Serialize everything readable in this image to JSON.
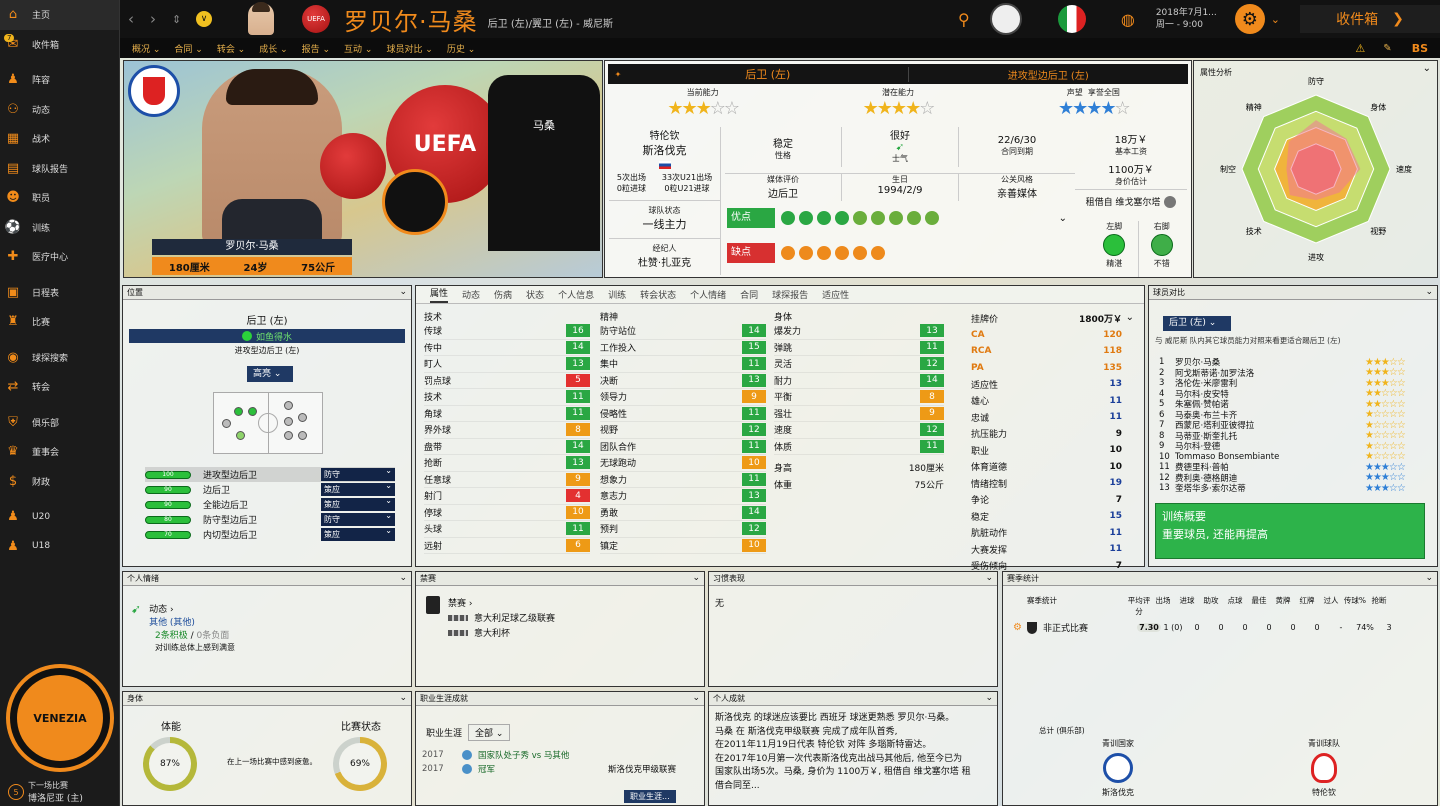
{
  "sidebar": {
    "items": [
      {
        "label": "主页",
        "icon": "home-icon",
        "glyph": "⌂",
        "selected": true
      },
      {
        "label": "收件箱",
        "icon": "inbox-icon",
        "glyph": "✉",
        "badge": "7"
      },
      {
        "label": "阵容",
        "icon": "squad-icon",
        "glyph": "♟"
      },
      {
        "label": "动态",
        "icon": "dynamics-icon",
        "glyph": "⚇"
      },
      {
        "label": "战术",
        "icon": "tactics-icon",
        "glyph": "▦"
      },
      {
        "label": "球队报告",
        "icon": "team-report-icon",
        "glyph": "▤"
      },
      {
        "label": "职员",
        "icon": "staff-icon",
        "glyph": "☻"
      },
      {
        "label": "训练",
        "icon": "training-icon",
        "glyph": "⚽"
      },
      {
        "label": "医疗中心",
        "icon": "medical-icon",
        "glyph": "✚"
      },
      {
        "label": "日程表",
        "icon": "calendar-icon",
        "glyph": "▣"
      },
      {
        "label": "比赛",
        "icon": "trophy-icon",
        "glyph": "♜"
      },
      {
        "label": "球探搜索",
        "icon": "scouting-icon",
        "glyph": "◉"
      },
      {
        "label": "转会",
        "icon": "transfer-icon",
        "glyph": "⇄"
      },
      {
        "label": "俱乐部",
        "icon": "club-icon",
        "glyph": "⛨"
      },
      {
        "label": "董事会",
        "icon": "board-icon",
        "glyph": "♛"
      },
      {
        "label": "财政",
        "icon": "finance-icon",
        "glyph": "$"
      },
      {
        "label": "U20",
        "icon": "u20-icon",
        "glyph": "♟"
      },
      {
        "label": "U18",
        "icon": "u18-icon",
        "glyph": "♟"
      }
    ],
    "next_match_label": "下一场比赛",
    "next_match_team": "博洛尼亚 (主)",
    "next_match_num": "5"
  },
  "topbar": {
    "player_name": "罗贝尔·马桑",
    "player_positions": "后卫 (左)/翼卫 (左) - 威尼斯",
    "date_line1": "2018年7月1...",
    "date_line2": "周一 - 9:00",
    "inbox_label": "收件箱",
    "uefa_label": "UEFA"
  },
  "subnav": [
    "概况",
    "合同",
    "转会",
    "成长",
    "报告",
    "互动",
    "球员对比",
    "历史"
  ],
  "banner": {
    "name": "罗贝尔·马桑",
    "height": "180厘米",
    "age": "24岁",
    "weight": "75公斤",
    "shirt_name": "马桑",
    "uefa_text": "UEFA",
    "club_badge_text": "VENEZIA"
  },
  "info": {
    "position_main": "后卫 (左)",
    "position_role": "进攻型边后卫 (左)",
    "current_ability_label": "当前能力",
    "current_ability_stars": 3.5,
    "potential_label": "潜在能力",
    "potential_stars": 4.5,
    "reputation_label": "声望",
    "reputation_value": "享誉全国",
    "reputation_stars": 4.5,
    "birthplace": "特伦钦",
    "nationality": "斯洛伐克",
    "apps_line1a": "5次出场",
    "apps_line1b": "0粒进球",
    "apps_line2a": "33次U21出场",
    "apps_line2b": "0粒U21进球",
    "personality_value": "稳定",
    "personality_label": "性格",
    "morale_value": "很好",
    "morale_label": "士气",
    "contract_value": "22/6/30",
    "contract_label": "合同到期",
    "wage_value": "18万￥",
    "wage_label": "基本工资",
    "value_value": "1100万￥",
    "value_label": "身价估计",
    "squad_status_label": "球队状态",
    "squad_status_value": "一线主力",
    "media_label": "媒体评价",
    "media_value": "边后卫",
    "dob_label": "生日",
    "dob_value": "1994/2/9",
    "pr_label": "公关风格",
    "pr_value": "亲善媒体",
    "loan_text": "租借自 维戈塞尔塔",
    "agent_label": "经纪人",
    "agent_value": "杜赞·扎亚克",
    "strengths_label": "优点",
    "weaknesses_label": "缺点",
    "left_foot_label": "左脚",
    "left_foot_value": "精湛",
    "right_foot_label": "右脚",
    "right_foot_value": "不错"
  },
  "attr_analysis": {
    "title": "属性分析",
    "labels": [
      "防守",
      "身体",
      "速度",
      "视野",
      "进攻",
      "技术",
      "制空",
      "精神"
    ],
    "values": [
      0.66,
      0.58,
      0.6,
      0.45,
      0.42,
      0.5,
      0.4,
      0.52
    ],
    "fill_colors": [
      "#9fcf5e",
      "#c6dd70",
      "#f0b43c",
      "#ee6b4f"
    ]
  },
  "position_panel": {
    "title": "位置",
    "main": "后卫 (左)",
    "role_highlight": "如鱼得水",
    "sub": "进攻型边后卫 (左)",
    "dropdown": "高亮",
    "roles": [
      {
        "rating": "100",
        "name": "进攻型边后卫",
        "duty": "防守"
      },
      {
        "rating": "90",
        "name": "边后卫",
        "duty": "策应"
      },
      {
        "rating": "90",
        "name": "全能边后卫",
        "duty": "策应"
      },
      {
        "rating": "80",
        "name": "防守型边后卫",
        "duty": "防守"
      },
      {
        "rating": "70",
        "name": "内切型边后卫",
        "duty": "策应"
      }
    ]
  },
  "attr_tabs": [
    "属性",
    "动态",
    "伤病",
    "状态",
    "个人信息",
    "训练",
    "转会状态",
    "个人情绪",
    "合同",
    "球探报告",
    "适应性"
  ],
  "attributes": {
    "technical_title": "技术",
    "mental_title": "精神",
    "physical_title": "身体",
    "technical": [
      {
        "n": "传球",
        "v": 16
      },
      {
        "n": "传中",
        "v": 14
      },
      {
        "n": "盯人",
        "v": 13
      },
      {
        "n": "罚点球",
        "v": 5
      },
      {
        "n": "技术",
        "v": 11
      },
      {
        "n": "角球",
        "v": 11
      },
      {
        "n": "界外球",
        "v": 8
      },
      {
        "n": "盘带",
        "v": 14
      },
      {
        "n": "抢断",
        "v": 13
      },
      {
        "n": "任意球",
        "v": 9
      },
      {
        "n": "射门",
        "v": 4
      },
      {
        "n": "停球",
        "v": 10
      },
      {
        "n": "头球",
        "v": 11
      },
      {
        "n": "远射",
        "v": 6
      }
    ],
    "mental": [
      {
        "n": "防守站位",
        "v": 14
      },
      {
        "n": "工作投入",
        "v": 15
      },
      {
        "n": "集中",
        "v": 11
      },
      {
        "n": "决断",
        "v": 13
      },
      {
        "n": "领导力",
        "v": 9
      },
      {
        "n": "侵略性",
        "v": 11
      },
      {
        "n": "视野",
        "v": 12
      },
      {
        "n": "团队合作",
        "v": 11
      },
      {
        "n": "无球跑动",
        "v": 10
      },
      {
        "n": "想象力",
        "v": 11
      },
      {
        "n": "意志力",
        "v": 13
      },
      {
        "n": "勇敢",
        "v": 14
      },
      {
        "n": "预判",
        "v": 12
      },
      {
        "n": "镇定",
        "v": 10
      }
    ],
    "physical": [
      {
        "n": "爆发力",
        "v": 13
      },
      {
        "n": "弹跳",
        "v": 11
      },
      {
        "n": "灵活",
        "v": 12
      },
      {
        "n": "耐力",
        "v": 14
      },
      {
        "n": "平衡",
        "v": 8
      },
      {
        "n": "强壮",
        "v": 9
      },
      {
        "n": "速度",
        "v": 12
      },
      {
        "n": "体质",
        "v": 11
      }
    ],
    "height_label": "身高",
    "height_value": "180厘米",
    "weight_label": "体重",
    "weight_value": "75公斤"
  },
  "hidden_attrs": [
    {
      "n": "挂牌价",
      "v": "1800万￥",
      "style": "plain"
    },
    {
      "n": "CA",
      "v": "120",
      "style": "orange"
    },
    {
      "n": "RCA",
      "v": "118",
      "style": "orange"
    },
    {
      "n": "PA",
      "v": "135",
      "style": "orange"
    },
    {
      "n": "适应性",
      "v": "13",
      "style": "blue"
    },
    {
      "n": "雄心",
      "v": "11",
      "style": "blue"
    },
    {
      "n": "忠诚",
      "v": "11",
      "style": "blue"
    },
    {
      "n": "抗压能力",
      "v": "9",
      "style": "plain"
    },
    {
      "n": "职业",
      "v": "10",
      "style": "plain"
    },
    {
      "n": "体育道德",
      "v": "10",
      "style": "plain"
    },
    {
      "n": "情绪控制",
      "v": "19",
      "style": "blue"
    },
    {
      "n": "争论",
      "v": "7",
      "style": "plain"
    },
    {
      "n": "稳定",
      "v": "15",
      "style": "blue"
    },
    {
      "n": "肮脏动作",
      "v": "11",
      "style": "blue"
    },
    {
      "n": "大赛发挥",
      "v": "11",
      "style": "blue"
    },
    {
      "n": "受伤倾向",
      "v": "7",
      "style": "plain"
    }
  ],
  "compare": {
    "title": "球员对比",
    "dropdown": "后卫 (左)",
    "desc": "与 威尼斯 队内其它球员能力对照来看更适合踢后卫 (左)",
    "rows": [
      {
        "n": "1",
        "name": "罗贝尔·马桑",
        "stars": 3.5,
        "color": "gold"
      },
      {
        "n": "2",
        "name": "阿戈斯蒂诺·加罗法洛",
        "stars": 3.5,
        "color": "gold"
      },
      {
        "n": "3",
        "name": "洛伦佐·米廖雷利",
        "stars": 3,
        "color": "gold"
      },
      {
        "n": "4",
        "name": "马尔科·皮安特",
        "stars": 2,
        "color": "gold"
      },
      {
        "n": "5",
        "name": "朱塞佩·赞帕诺",
        "stars": 2,
        "color": "gold"
      },
      {
        "n": "6",
        "name": "马泰奥·布兰卡齐",
        "stars": 1.5,
        "color": "gold"
      },
      {
        "n": "7",
        "name": "西蒙尼·塔利亚彼得拉",
        "stars": 1.5,
        "color": "gold"
      },
      {
        "n": "8",
        "name": "马蒂亚·斯奎扎托",
        "stars": 1.5,
        "color": "gold"
      },
      {
        "n": "9",
        "name": "马尔科·登德",
        "stars": 1.5,
        "color": "gold"
      },
      {
        "n": "10",
        "name": "Tommaso Bonsembiante",
        "stars": 1,
        "color": "gold"
      },
      {
        "n": "11",
        "name": "费德里科·普帕",
        "stars": 3,
        "color": "blue"
      },
      {
        "n": "12",
        "name": "费利奥·德格朗迪",
        "stars": 3,
        "color": "blue"
      },
      {
        "n": "13",
        "name": "奎塔华多·索尔达蒂",
        "stars": 3,
        "color": "blue"
      }
    ],
    "training_title": "训练概要",
    "training_text": "重要球员, 还能再提高"
  },
  "mood": {
    "title": "个人情绪",
    "dyn_label": "动态",
    "dyn_value": "其他 (其他)",
    "pos_count": "2条积极",
    "neg_count": "0条负面",
    "note": "对训练总体上感到满意"
  },
  "bans": {
    "title": "禁赛",
    "label": "禁赛",
    "items": [
      "意大利足球乙级联赛",
      "意大利杯"
    ]
  },
  "habits": {
    "title": "习惯表现",
    "value": "无"
  },
  "match_stats": {
    "title": "赛季统计",
    "col_label": "赛季统计",
    "headers": [
      "平均评分",
      "出场",
      "进球",
      "助攻",
      "点球",
      "最佳",
      "黄牌",
      "红牌",
      "过人",
      "传球%",
      "抢断"
    ],
    "row_label": "非正式比赛",
    "values": [
      "7.30",
      "1 (0)",
      "0",
      "0",
      "0",
      "0",
      "0",
      "0",
      "-",
      "74%",
      "3"
    ],
    "total_label": "总计 (俱乐部)",
    "youth_nation_label": "青训国家",
    "youth_nation_value": "斯洛伐克",
    "youth_club_label": "青训球队",
    "youth_club_value": "特伦钦"
  },
  "physique": {
    "title": "身体",
    "stamina_label": "体能",
    "stamina_value": "87%",
    "stamina_pct": 87,
    "tired_note": "在上一场比赛中感到疲惫。",
    "fitness_label": "比赛状态",
    "fitness_value": "69%",
    "fitness_pct": 69
  },
  "career": {
    "title": "职业生涯成就",
    "filter_label": "职业生涯",
    "filter_value": "全部",
    "rows": [
      {
        "year": "2017",
        "text": "国家队处子秀 vs 马其他",
        "sub": ""
      },
      {
        "year": "2017",
        "text": "冠军",
        "sub": "斯洛伐克甲级联赛"
      }
    ],
    "button": "职业生涯..."
  },
  "achievements": {
    "title": "个人成就",
    "lines": [
      "斯洛伐克 的球迷应该要比 西班牙 球迷更熟悉 罗贝尔·马桑。",
      "马桑 在 斯洛伐克甲级联赛 完成了成年队首秀,",
      "在2011年11月19日代表 特伦钦 对阵 多瑙斯特雷达。",
      "在2017年10月第一次代表斯洛伐克出战马其他后, 他至今已为",
      "国家队出场5次。马桑, 身价为 1100万￥, 租借自 维戈塞尔塔 租",
      "借合同至..."
    ]
  },
  "colors": {
    "accent": "#f08a1c",
    "good": "#2aa743",
    "medium": "#ee9a16",
    "bad": "#e33030",
    "navy": "#122447"
  }
}
